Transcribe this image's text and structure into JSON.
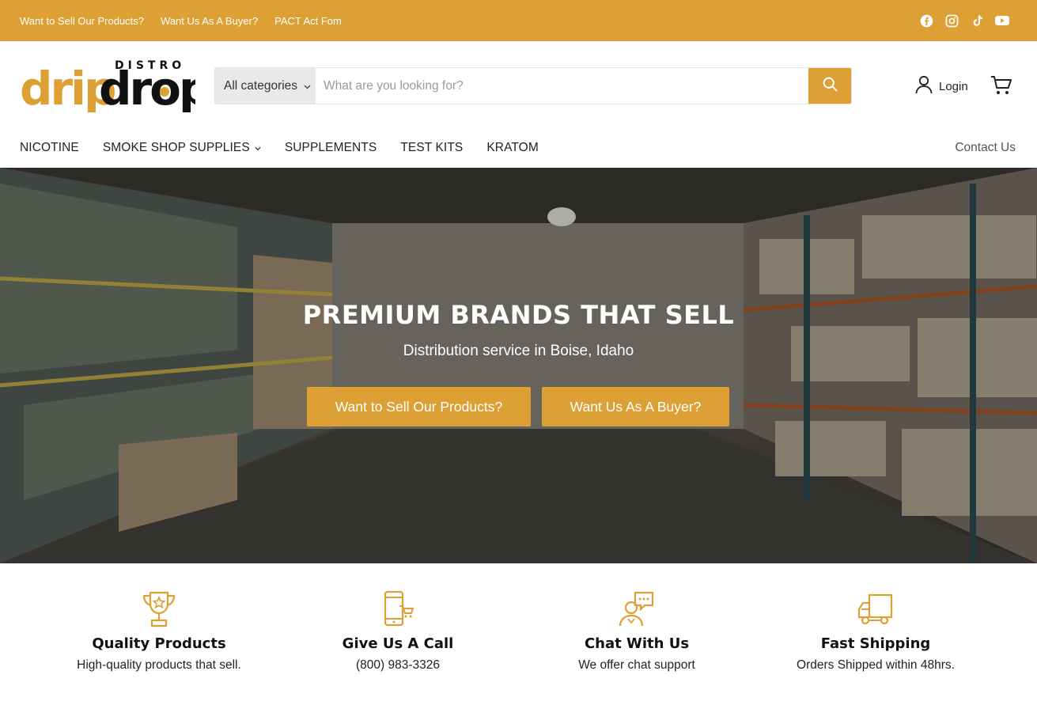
{
  "topbar": {
    "links": [
      "Want to Sell Our Products?",
      "Want Us As A Buyer?",
      "PACT Act Fom"
    ],
    "social_icons": [
      "facebook-icon",
      "instagram-icon",
      "tiktok-icon",
      "youtube-icon"
    ]
  },
  "header": {
    "logo": {
      "text_main": "dripdrop",
      "text_small": "DISTRO"
    },
    "search": {
      "category": "All categories",
      "placeholder": "What are you looking for?"
    },
    "login_label": "Login"
  },
  "nav": {
    "items": [
      "NICOTINE",
      "SMOKE SHOP SUPPLIES",
      "SUPPLEMENTS",
      "TEST KITS",
      "KRATOM"
    ],
    "contact": "Contact Us"
  },
  "hero": {
    "title": "PREMIUM BRANDS THAT SELL",
    "subtitle": "Distribution service in Boise, Idaho",
    "button_sell": "Want to Sell Our Products?",
    "button_buyer": "Want Us As A Buyer?"
  },
  "features": [
    {
      "icon": "trophy-icon",
      "title": "Quality Products",
      "text": "High-quality products that sell."
    },
    {
      "icon": "phone-icon",
      "title": "Give Us A Call",
      "text": "(800) 983-3326"
    },
    {
      "icon": "chat-support-icon",
      "title": "Chat With Us",
      "text": "We offer chat support"
    },
    {
      "icon": "truck-icon",
      "title": "Fast Shipping",
      "text": "Orders Shipped within 48hrs."
    }
  ],
  "colors": {
    "accent": "#dca035",
    "text": "#222222"
  }
}
